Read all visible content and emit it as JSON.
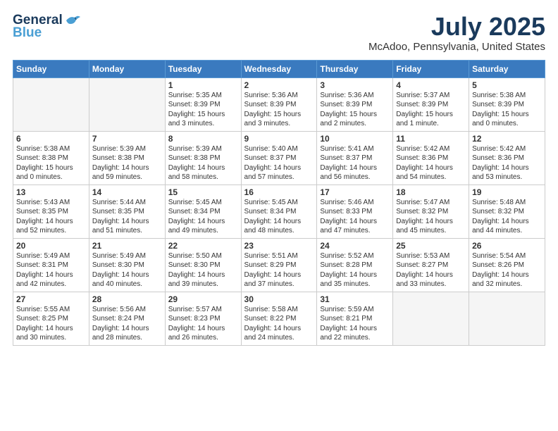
{
  "header": {
    "logo_line1": "General",
    "logo_line2": "Blue",
    "month_year": "July 2025",
    "location": "McAdoo, Pennsylvania, United States"
  },
  "days_of_week": [
    "Sunday",
    "Monday",
    "Tuesday",
    "Wednesday",
    "Thursday",
    "Friday",
    "Saturday"
  ],
  "weeks": [
    [
      {
        "day": "",
        "empty": true
      },
      {
        "day": "",
        "empty": true
      },
      {
        "day": "1",
        "sunrise": "5:35 AM",
        "sunset": "8:39 PM",
        "daylight": "15 hours and 3 minutes."
      },
      {
        "day": "2",
        "sunrise": "5:36 AM",
        "sunset": "8:39 PM",
        "daylight": "15 hours and 3 minutes."
      },
      {
        "day": "3",
        "sunrise": "5:36 AM",
        "sunset": "8:39 PM",
        "daylight": "15 hours and 2 minutes."
      },
      {
        "day": "4",
        "sunrise": "5:37 AM",
        "sunset": "8:39 PM",
        "daylight": "15 hours and 1 minute."
      },
      {
        "day": "5",
        "sunrise": "5:38 AM",
        "sunset": "8:39 PM",
        "daylight": "15 hours and 0 minutes."
      }
    ],
    [
      {
        "day": "6",
        "sunrise": "5:38 AM",
        "sunset": "8:38 PM",
        "daylight": "15 hours and 0 minutes."
      },
      {
        "day": "7",
        "sunrise": "5:39 AM",
        "sunset": "8:38 PM",
        "daylight": "14 hours and 59 minutes."
      },
      {
        "day": "8",
        "sunrise": "5:39 AM",
        "sunset": "8:38 PM",
        "daylight": "14 hours and 58 minutes."
      },
      {
        "day": "9",
        "sunrise": "5:40 AM",
        "sunset": "8:37 PM",
        "daylight": "14 hours and 57 minutes."
      },
      {
        "day": "10",
        "sunrise": "5:41 AM",
        "sunset": "8:37 PM",
        "daylight": "14 hours and 56 minutes."
      },
      {
        "day": "11",
        "sunrise": "5:42 AM",
        "sunset": "8:36 PM",
        "daylight": "14 hours and 54 minutes."
      },
      {
        "day": "12",
        "sunrise": "5:42 AM",
        "sunset": "8:36 PM",
        "daylight": "14 hours and 53 minutes."
      }
    ],
    [
      {
        "day": "13",
        "sunrise": "5:43 AM",
        "sunset": "8:35 PM",
        "daylight": "14 hours and 52 minutes."
      },
      {
        "day": "14",
        "sunrise": "5:44 AM",
        "sunset": "8:35 PM",
        "daylight": "14 hours and 51 minutes."
      },
      {
        "day": "15",
        "sunrise": "5:45 AM",
        "sunset": "8:34 PM",
        "daylight": "14 hours and 49 minutes."
      },
      {
        "day": "16",
        "sunrise": "5:45 AM",
        "sunset": "8:34 PM",
        "daylight": "14 hours and 48 minutes."
      },
      {
        "day": "17",
        "sunrise": "5:46 AM",
        "sunset": "8:33 PM",
        "daylight": "14 hours and 47 minutes."
      },
      {
        "day": "18",
        "sunrise": "5:47 AM",
        "sunset": "8:32 PM",
        "daylight": "14 hours and 45 minutes."
      },
      {
        "day": "19",
        "sunrise": "5:48 AM",
        "sunset": "8:32 PM",
        "daylight": "14 hours and 44 minutes."
      }
    ],
    [
      {
        "day": "20",
        "sunrise": "5:49 AM",
        "sunset": "8:31 PM",
        "daylight": "14 hours and 42 minutes."
      },
      {
        "day": "21",
        "sunrise": "5:49 AM",
        "sunset": "8:30 PM",
        "daylight": "14 hours and 40 minutes."
      },
      {
        "day": "22",
        "sunrise": "5:50 AM",
        "sunset": "8:30 PM",
        "daylight": "14 hours and 39 minutes."
      },
      {
        "day": "23",
        "sunrise": "5:51 AM",
        "sunset": "8:29 PM",
        "daylight": "14 hours and 37 minutes."
      },
      {
        "day": "24",
        "sunrise": "5:52 AM",
        "sunset": "8:28 PM",
        "daylight": "14 hours and 35 minutes."
      },
      {
        "day": "25",
        "sunrise": "5:53 AM",
        "sunset": "8:27 PM",
        "daylight": "14 hours and 33 minutes."
      },
      {
        "day": "26",
        "sunrise": "5:54 AM",
        "sunset": "8:26 PM",
        "daylight": "14 hours and 32 minutes."
      }
    ],
    [
      {
        "day": "27",
        "sunrise": "5:55 AM",
        "sunset": "8:25 PM",
        "daylight": "14 hours and 30 minutes."
      },
      {
        "day": "28",
        "sunrise": "5:56 AM",
        "sunset": "8:24 PM",
        "daylight": "14 hours and 28 minutes."
      },
      {
        "day": "29",
        "sunrise": "5:57 AM",
        "sunset": "8:23 PM",
        "daylight": "14 hours and 26 minutes."
      },
      {
        "day": "30",
        "sunrise": "5:58 AM",
        "sunset": "8:22 PM",
        "daylight": "14 hours and 24 minutes."
      },
      {
        "day": "31",
        "sunrise": "5:59 AM",
        "sunset": "8:21 PM",
        "daylight": "14 hours and 22 minutes."
      },
      {
        "day": "",
        "empty": true
      },
      {
        "day": "",
        "empty": true
      }
    ]
  ]
}
